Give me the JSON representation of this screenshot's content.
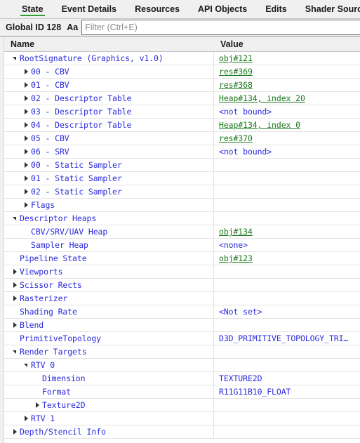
{
  "tabs": [
    {
      "label": "State",
      "active": true
    },
    {
      "label": "Event Details",
      "active": false
    },
    {
      "label": "Resources",
      "active": false
    },
    {
      "label": "API Objects",
      "active": false
    },
    {
      "label": "Edits",
      "active": false
    },
    {
      "label": "Shader Sources",
      "active": false
    }
  ],
  "filterbar": {
    "global_id_label": "Global ID 128",
    "match_case_label": "Aa",
    "filter_placeholder": "Filter (Ctrl+E)",
    "filter_value": ""
  },
  "table": {
    "headers": {
      "name": "Name",
      "value": "Value"
    },
    "rows": [
      {
        "indent": 0,
        "twisty": "expanded",
        "name": "RootSignature (Graphics, v1.0)",
        "value": "obj#121",
        "value_kind": "link"
      },
      {
        "indent": 1,
        "twisty": "collapsed",
        "name": "00 - CBV",
        "value": "res#369",
        "value_kind": "link"
      },
      {
        "indent": 1,
        "twisty": "collapsed",
        "name": "01 - CBV",
        "value": "res#368",
        "value_kind": "link"
      },
      {
        "indent": 1,
        "twisty": "collapsed",
        "name": "02 - Descriptor Table",
        "value": "Heap#134, index 20",
        "value_kind": "link"
      },
      {
        "indent": 1,
        "twisty": "collapsed",
        "name": "03 - Descriptor Table",
        "value": "<not bound>",
        "value_kind": "plain"
      },
      {
        "indent": 1,
        "twisty": "collapsed",
        "name": "04 - Descriptor Table",
        "value": "Heap#134, index 0",
        "value_kind": "link"
      },
      {
        "indent": 1,
        "twisty": "collapsed",
        "name": "05 - CBV",
        "value": "res#370",
        "value_kind": "link"
      },
      {
        "indent": 1,
        "twisty": "collapsed",
        "name": "06 - SRV",
        "value": "<not bound>",
        "value_kind": "plain"
      },
      {
        "indent": 1,
        "twisty": "collapsed",
        "name": "00 - Static Sampler",
        "value": "",
        "value_kind": "plain"
      },
      {
        "indent": 1,
        "twisty": "collapsed",
        "name": "01 - Static Sampler",
        "value": "",
        "value_kind": "plain"
      },
      {
        "indent": 1,
        "twisty": "collapsed",
        "name": "02 - Static Sampler",
        "value": "",
        "value_kind": "plain"
      },
      {
        "indent": 1,
        "twisty": "collapsed",
        "name": "Flags",
        "value": "",
        "value_kind": "plain"
      },
      {
        "indent": 0,
        "twisty": "expanded",
        "name": "Descriptor Heaps",
        "value": "",
        "value_kind": "plain"
      },
      {
        "indent": 1,
        "twisty": "none",
        "name": "CBV/SRV/UAV Heap",
        "value": "obj#134",
        "value_kind": "link"
      },
      {
        "indent": 1,
        "twisty": "none",
        "name": "Sampler Heap",
        "value": "<none>",
        "value_kind": "plain"
      },
      {
        "indent": 0,
        "twisty": "none",
        "name": "Pipeline State",
        "value": "obj#123",
        "value_kind": "link"
      },
      {
        "indent": 0,
        "twisty": "collapsed",
        "name": "Viewports",
        "value": "",
        "value_kind": "plain"
      },
      {
        "indent": 0,
        "twisty": "collapsed",
        "name": "Scissor Rects",
        "value": "",
        "value_kind": "plain"
      },
      {
        "indent": 0,
        "twisty": "collapsed",
        "name": "Rasterizer",
        "value": "",
        "value_kind": "plain"
      },
      {
        "indent": 0,
        "twisty": "none",
        "name": "Shading Rate",
        "value": "<Not set>",
        "value_kind": "plain"
      },
      {
        "indent": 0,
        "twisty": "collapsed",
        "name": "Blend",
        "value": "",
        "value_kind": "plain"
      },
      {
        "indent": 0,
        "twisty": "none",
        "name": "PrimitiveTopology",
        "value": "D3D_PRIMITIVE_TOPOLOGY_TRI…",
        "value_kind": "plain"
      },
      {
        "indent": 0,
        "twisty": "expanded",
        "name": "Render Targets",
        "value": "",
        "value_kind": "plain"
      },
      {
        "indent": 1,
        "twisty": "expanded",
        "name": "RTV 0",
        "value": "",
        "value_kind": "plain"
      },
      {
        "indent": 2,
        "twisty": "none",
        "name": "Dimension",
        "value": "TEXTURE2D",
        "value_kind": "plain"
      },
      {
        "indent": 2,
        "twisty": "none",
        "name": "Format",
        "value": "R11G11B10_FLOAT",
        "value_kind": "plain"
      },
      {
        "indent": 2,
        "twisty": "collapsed",
        "name": "Texture2D",
        "value": "",
        "value_kind": "plain"
      },
      {
        "indent": 1,
        "twisty": "collapsed",
        "name": "RTV 1",
        "value": "",
        "value_kind": "plain"
      },
      {
        "indent": 0,
        "twisty": "collapsed",
        "name": "Depth/Stencil Info",
        "value": "",
        "value_kind": "plain"
      }
    ]
  },
  "colors": {
    "accent_green": "#2e9e2e",
    "link_green": "#1e7a1e",
    "tree_blue": "#2b2bdd",
    "chrome_gray": "#f0f0f0"
  }
}
